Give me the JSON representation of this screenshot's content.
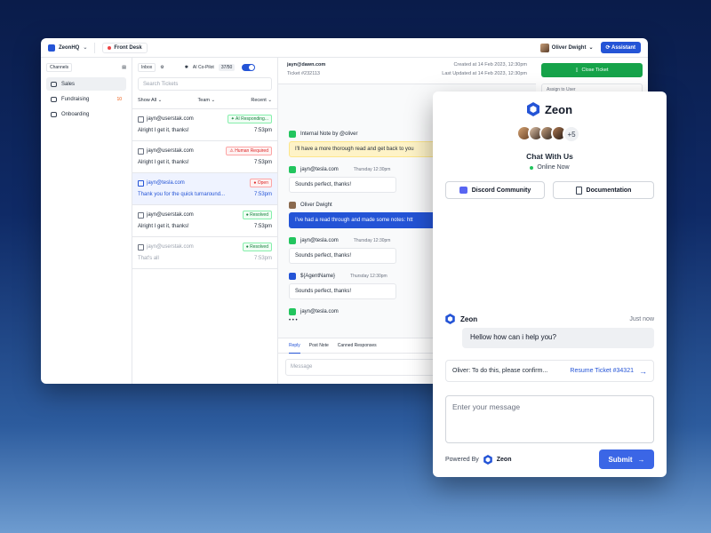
{
  "app": {
    "workspace": "ZeonHQ",
    "desk": "Front Desk",
    "user_name": "Oliver Dwight",
    "assistant_label": "Assistant"
  },
  "sidebar": {
    "section_label": "Channels",
    "items": [
      {
        "label": "Sales",
        "count": ""
      },
      {
        "label": "Fundraising",
        "count": "10"
      },
      {
        "label": "Onboarding",
        "count": ""
      }
    ]
  },
  "tickets": {
    "inbox_label": "Inbox",
    "copilot_label": "AI Co-Pilot",
    "copilot_count": "37/50",
    "search_placeholder": "Search Tickets",
    "filter_show": "Show All",
    "filter_team": "Team",
    "filter_sort": "Recent",
    "items": [
      {
        "email": "jayn@userstak.com",
        "status": "AI Responding...",
        "preview": "Alright I get it, thanks!",
        "time": "7:53pm"
      },
      {
        "email": "jayn@userstak.com",
        "status": "Human Required",
        "preview": "Alright I get it, thanks!",
        "time": "7:53pm"
      },
      {
        "email": "jayn@tesla.com",
        "status": "Open",
        "preview": "Thank you for the quick turnaround...",
        "time": "7:53pm"
      },
      {
        "email": "jayn@userstak.com",
        "status": "Resolved",
        "preview": "Alright I get it, thanks!",
        "time": "7:53pm"
      },
      {
        "email": "jayn@userstak.com",
        "status": "Resolved",
        "preview": "That's all",
        "time": "7:53pm"
      }
    ]
  },
  "conversation": {
    "email": "jayn@dawn.com",
    "ticket": "Ticket #232113",
    "created": "Created at 14 Feb 2023, 12:30pm",
    "updated": "Last Updated at 14 Feb 2023, 12:30pm",
    "messages": [
      {
        "sender": "Internal Note by @oliver",
        "time": "",
        "text": "I'll have a more thorough read and get back to you"
      },
      {
        "sender": "jayn@tesla.com",
        "time": "Thursday 12:30pm",
        "text": "Sounds perfect, thanks!"
      },
      {
        "sender": "Oliver Dwight",
        "time": "",
        "text": "I've had a read through and made some notes: htt"
      },
      {
        "sender": "jayn@tesla.com",
        "time": "Thursday 12:30pm",
        "text": "Sounds perfect, thanks!"
      },
      {
        "sender": "${AgentName}",
        "time": "Thursday 12:30pm",
        "text": "Sounds perfect, thanks!"
      },
      {
        "sender": "jayn@tesla.com",
        "time": "",
        "text": "• • •"
      }
    ],
    "reply_tabs": [
      "Reply",
      "Post Note",
      "Canned Responses"
    ],
    "message_placeholder": "Message"
  },
  "details": {
    "close_label": "Close Ticket",
    "assign_placeholder": "Assign to User"
  },
  "widget": {
    "brand": "Zeon",
    "more_count": "+5",
    "title": "Chat With Us",
    "status": "Online Now",
    "discord_label": "Discord Community",
    "docs_label": "Documentation",
    "agent_name": "Zeon",
    "agent_time": "Just now",
    "agent_message": "Hellow how can i help you?",
    "resume_text": "Oliver: To do this, please confirm...",
    "resume_link": "Resume Ticket #34321",
    "input_placeholder": "Enter your message",
    "powered_by": "Powered By",
    "powered_brand": "Zeon",
    "submit_label": "Submit"
  },
  "colors": {
    "accent": "#2454d6",
    "success": "#16a34a",
    "danger": "#dc2626",
    "online": "#22c55e"
  }
}
